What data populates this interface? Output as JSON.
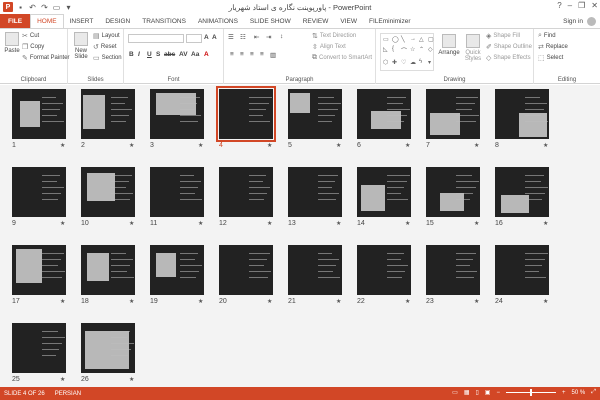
{
  "titlebar": {
    "title": "پاورپوینت نگاره ی استاد شهریار - PowerPoint",
    "app_icon": "P",
    "qat_icons": [
      "save-icon",
      "undo-icon",
      "redo-icon",
      "start-from-beginning-icon",
      "customize-icon"
    ],
    "help": "?",
    "minimize": "–",
    "restore": "❐",
    "close": "✕"
  },
  "tabs": {
    "file": "FILE",
    "items": [
      "HOME",
      "INSERT",
      "DESIGN",
      "TRANSITIONS",
      "ANIMATIONS",
      "SLIDE SHOW",
      "REVIEW",
      "VIEW",
      "FILEminimizer"
    ],
    "active": "HOME",
    "sign_in": "Sign in"
  },
  "ribbon": {
    "clipboard": {
      "paste": "Paste",
      "cut": "Cut",
      "copy": "Copy",
      "format_painter": "Format Painter",
      "label": "Clipboard"
    },
    "slides": {
      "new_slide": "New Slide",
      "layout": "Layout",
      "reset": "Reset",
      "section": "Section",
      "label": "Slides"
    },
    "font": {
      "label": "Font",
      "bold": "B",
      "italic": "I",
      "underline": "U",
      "strike": "S",
      "shadow": "abc",
      "spacing": "AV",
      "case": "Aa",
      "color": "A"
    },
    "paragraph": {
      "text_direction": "Text Direction",
      "align_text": "Align Text",
      "convert_smartart": "Convert to SmartArt",
      "label": "Paragraph"
    },
    "drawing": {
      "arrange": "Arrange",
      "quick_styles": "Quick Styles",
      "shape_fill": "Shape Fill",
      "shape_outline": "Shape Outline",
      "shape_effects": "Shape Effects",
      "label": "Drawing"
    },
    "editing": {
      "find": "Find",
      "replace": "Replace",
      "select": "Select",
      "label": "Editing"
    }
  },
  "slides": [
    {
      "n": "1"
    },
    {
      "n": "2"
    },
    {
      "n": "3"
    },
    {
      "n": "4"
    },
    {
      "n": "5"
    },
    {
      "n": "6"
    },
    {
      "n": "7"
    },
    {
      "n": "8"
    },
    {
      "n": "9"
    },
    {
      "n": "10"
    },
    {
      "n": "11"
    },
    {
      "n": "12"
    },
    {
      "n": "13"
    },
    {
      "n": "14"
    },
    {
      "n": "15"
    },
    {
      "n": "16"
    },
    {
      "n": "17"
    },
    {
      "n": "18"
    },
    {
      "n": "19"
    },
    {
      "n": "20"
    },
    {
      "n": "21"
    },
    {
      "n": "22"
    },
    {
      "n": "23"
    },
    {
      "n": "24"
    },
    {
      "n": "25"
    },
    {
      "n": "26"
    }
  ],
  "selected_slide": "4",
  "star_glyph": "★",
  "statusbar": {
    "slide_info": "SLIDE 4 OF 26",
    "language": "PERSIAN",
    "zoom": "50 %",
    "zoom_level": 0.5
  },
  "colors": {
    "accent": "#d24726",
    "slide_bg": "#222222"
  }
}
